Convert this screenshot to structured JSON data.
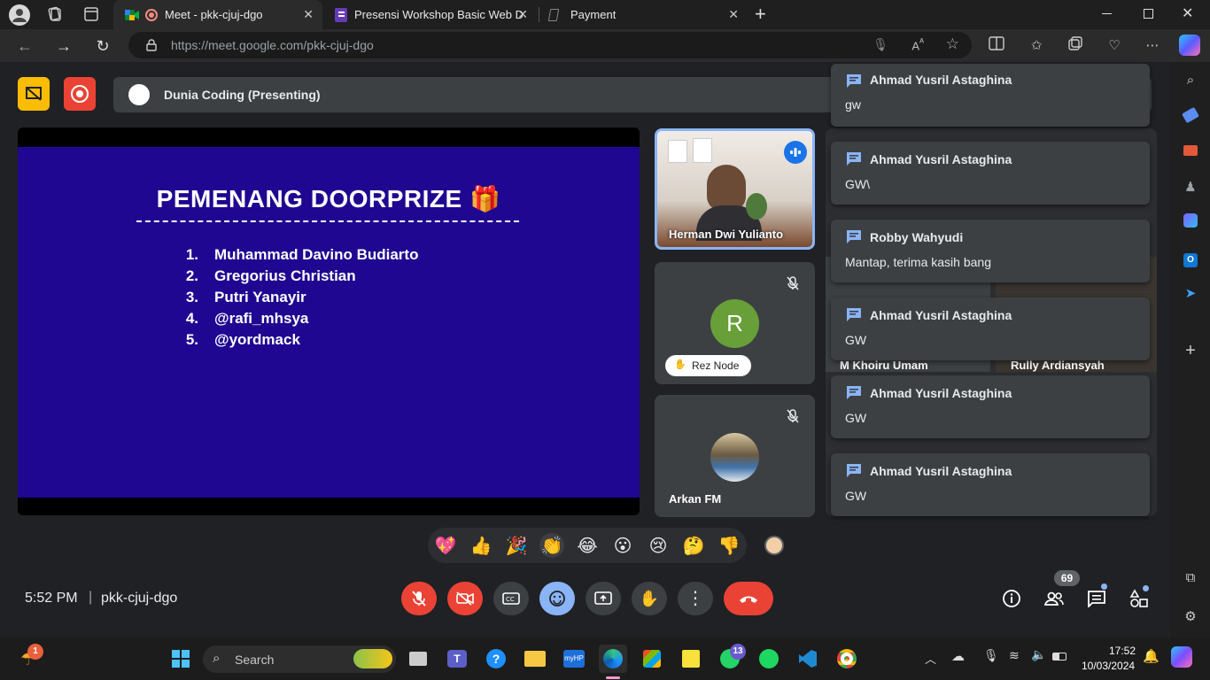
{
  "browser": {
    "tabs": [
      {
        "title": "Meet - pkk-cjuj-dgo",
        "active": true
      },
      {
        "title": "Presensi Workshop Basic Web De",
        "active": false
      },
      {
        "title": "Payment",
        "active": false
      }
    ],
    "url_host": "https://meet.google.com",
    "url_path": "/pkk-cjuj-dgo"
  },
  "meet": {
    "presenting_label": "Dunia Coding (Presenting)",
    "slide": {
      "title": "PEMENANG DOORPRIZE 🎁",
      "winners": [
        {
          "num": "1.",
          "name": "Muhammad Davino Budiarto"
        },
        {
          "num": "2.",
          "name": "Gregorius Christian"
        },
        {
          "num": "3.",
          "name": "Putri Yanayir"
        },
        {
          "num": "4.",
          "name": "@rafi_mhsya"
        },
        {
          "num": "5.",
          "name": "@yordmack"
        }
      ]
    },
    "participants": {
      "speaking": "Herman Dwi Yulianto",
      "rez_node": "Rez Node",
      "rez_initial": "R",
      "arkan": "Arkan FM",
      "partial_left": "M Khoiru Umam",
      "partial_right": "Rully Ardiansyah"
    },
    "chat_notifications": [
      {
        "sender": "Ahmad Yusril Astaghina",
        "message": "gw"
      },
      {
        "sender": "Ahmad Yusril Astaghina",
        "message": "GW\\"
      },
      {
        "sender": "Robby Wahyudi",
        "message": "Mantap, terima kasih bang"
      },
      {
        "sender": "Ahmad Yusril Astaghina",
        "message": "GW"
      },
      {
        "sender": "Ahmad Yusril Astaghina",
        "message": "GW"
      },
      {
        "sender": "Ahmad Yusril Astaghina",
        "message": "GW"
      }
    ],
    "reactions": [
      "💖",
      "👍",
      "🎉",
      "👏",
      "😂",
      "😮",
      "😢",
      "🤔",
      "👎"
    ],
    "time": "5:52 PM",
    "separator": "|",
    "meeting_code": "pkk-cjuj-dgo",
    "participant_count": "69",
    "accent_red": "#ea4335",
    "accent_blue": "#8ab4f8"
  },
  "taskbar": {
    "search_label": "Search",
    "clock_time": "17:52",
    "clock_date": "10/03/2024",
    "whatsapp_badge": "13",
    "notif_badge": "1"
  }
}
